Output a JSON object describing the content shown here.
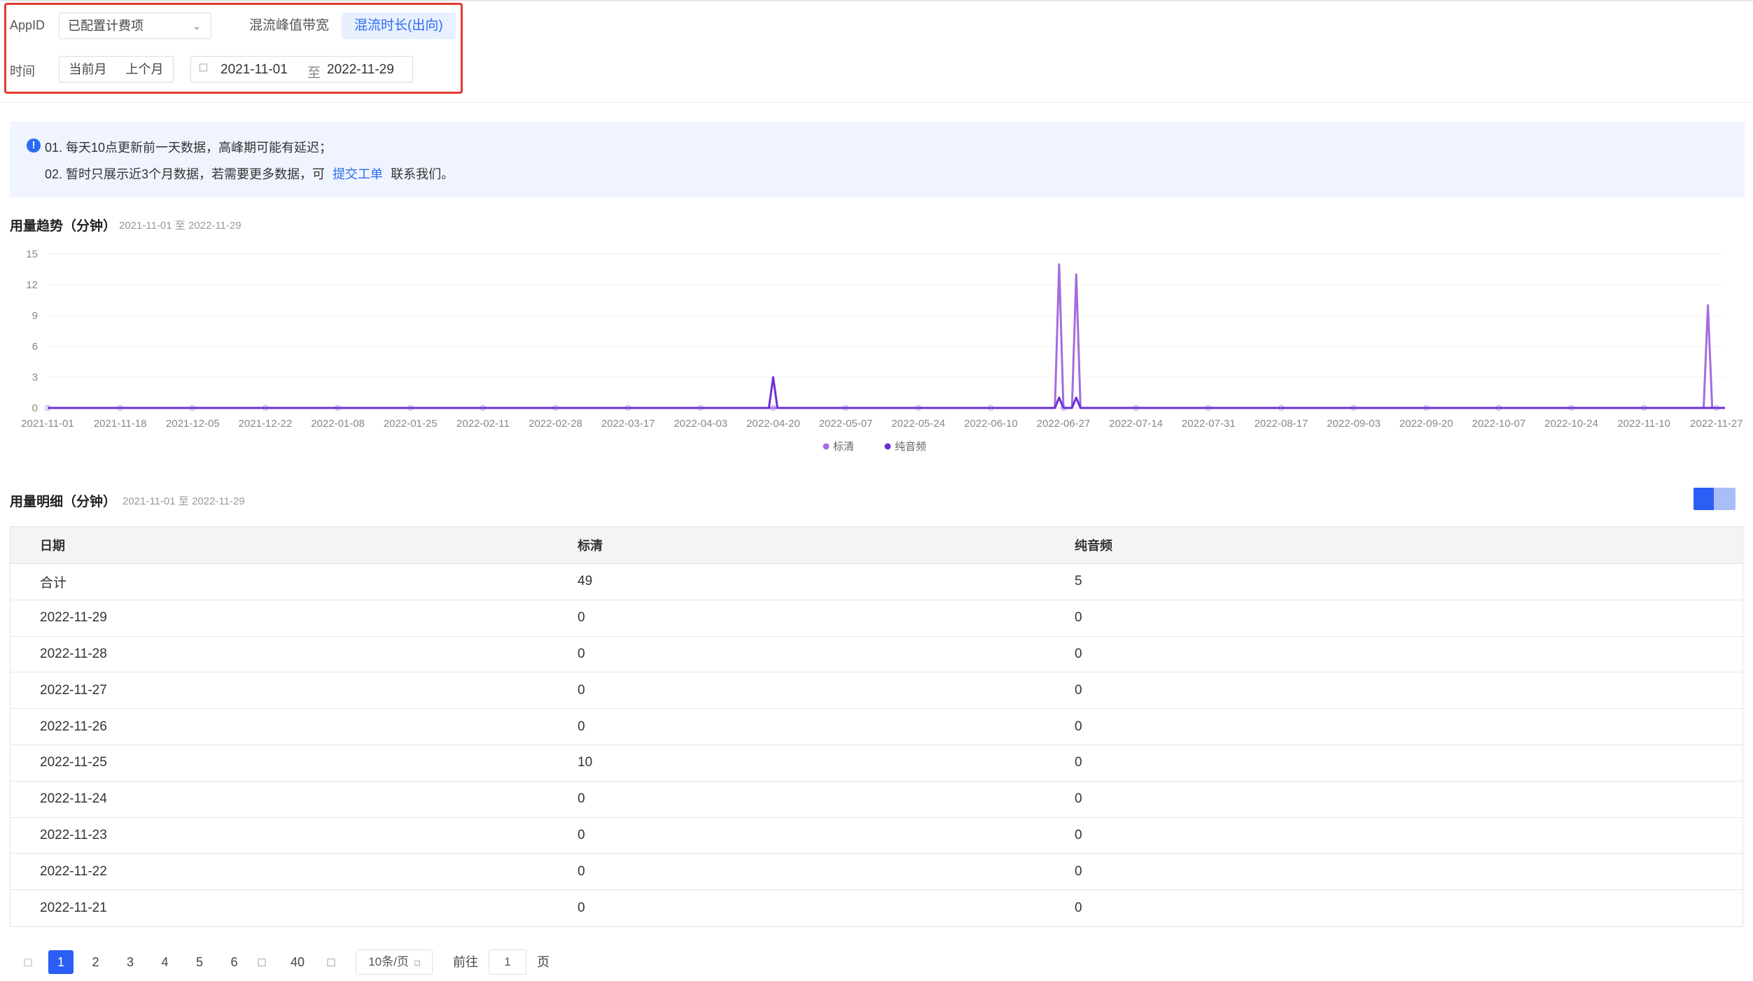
{
  "filters": {
    "appid_label": "AppID",
    "appid_value": "已配置计费项",
    "tabs": [
      "混流峰值带宽",
      "混流时长(出向)"
    ],
    "active_tab": 1,
    "time_label": "时间",
    "quick_ranges": [
      "当前月",
      "上个月"
    ],
    "date_start": "2021-11-01",
    "date_sep": "至",
    "date_end": "2022-11-29"
  },
  "notice": {
    "line1": "01. 每天10点更新前一天数据，高峰期可能有延迟；",
    "line2_prefix": "02. 暂时只展示近3个月数据，若需要更多数据，可",
    "line2_link": "提交工单",
    "line2_suffix": "联系我们。"
  },
  "trend": {
    "title": "用量趋势（分钟）",
    "range": "2021-11-01 至 2022-11-29"
  },
  "detail": {
    "title": "用量明细（分钟）",
    "range": "2021-11-01 至 2022-11-29"
  },
  "chart_data": {
    "type": "line",
    "title": "用量趋势（分钟）",
    "xlabel": "",
    "ylabel": "",
    "ylim": [
      0,
      15
    ],
    "y_ticks": [
      0,
      3,
      6,
      9,
      12,
      15
    ],
    "x_tick_labels": [
      "2021-11-01",
      "2021-11-18",
      "2021-12-05",
      "2021-12-22",
      "2022-01-08",
      "2022-01-25",
      "2022-02-11",
      "2022-02-28",
      "2022-03-17",
      "2022-04-03",
      "2022-04-20",
      "2022-05-07",
      "2022-05-24",
      "2022-06-10",
      "2022-06-27",
      "2022-07-14",
      "2022-07-31",
      "2022-08-17",
      "2022-09-03",
      "2022-09-20",
      "2022-10-07",
      "2022-10-24",
      "2022-11-10",
      "2022-11-27"
    ],
    "grid": true,
    "legend": "bottom-center",
    "series": [
      {
        "name": "标清",
        "color": "#a66bdf",
        "points": [
          [
            "2021-11-01",
            0
          ],
          [
            "2022-06-25",
            0
          ],
          [
            "2022-06-26",
            14
          ],
          [
            "2022-06-27",
            0
          ],
          [
            "2022-06-29",
            0
          ],
          [
            "2022-06-30",
            13
          ],
          [
            "2022-07-01",
            0
          ],
          [
            "2022-11-24",
            0
          ],
          [
            "2022-11-25",
            10
          ],
          [
            "2022-11-26",
            0
          ],
          [
            "2022-11-29",
            0
          ]
        ]
      },
      {
        "name": "纯音频",
        "color": "#6c2fd6",
        "points": [
          [
            "2021-11-01",
            0
          ],
          [
            "2022-04-19",
            0
          ],
          [
            "2022-04-20",
            3
          ],
          [
            "2022-04-21",
            0
          ],
          [
            "2022-06-25",
            0
          ],
          [
            "2022-06-26",
            1
          ],
          [
            "2022-06-27",
            0
          ],
          [
            "2022-06-29",
            0
          ],
          [
            "2022-06-30",
            1
          ],
          [
            "2022-07-01",
            0
          ],
          [
            "2022-11-29",
            0
          ]
        ]
      }
    ]
  },
  "table": {
    "headers": [
      "日期",
      "标清",
      "纯音频"
    ],
    "rows": [
      [
        "合计",
        "49",
        "5"
      ],
      [
        "2022-11-29",
        "0",
        "0"
      ],
      [
        "2022-11-28",
        "0",
        "0"
      ],
      [
        "2022-11-27",
        "0",
        "0"
      ],
      [
        "2022-11-26",
        "0",
        "0"
      ],
      [
        "2022-11-25",
        "10",
        "0"
      ],
      [
        "2022-11-24",
        "0",
        "0"
      ],
      [
        "2022-11-23",
        "0",
        "0"
      ],
      [
        "2022-11-22",
        "0",
        "0"
      ],
      [
        "2022-11-21",
        "0",
        "0"
      ]
    ]
  },
  "pagination": {
    "pages": [
      "1",
      "2",
      "3",
      "4",
      "5",
      "6"
    ],
    "last_page": "40",
    "page_size": "10条/页",
    "goto_label": "前往",
    "goto_value": "1",
    "page_unit": "页"
  },
  "colors": {
    "accent": "#2b6cf0",
    "standard": "#a66bdf",
    "audio": "#6c2fd6",
    "highlight_border": "#e23b2f"
  }
}
